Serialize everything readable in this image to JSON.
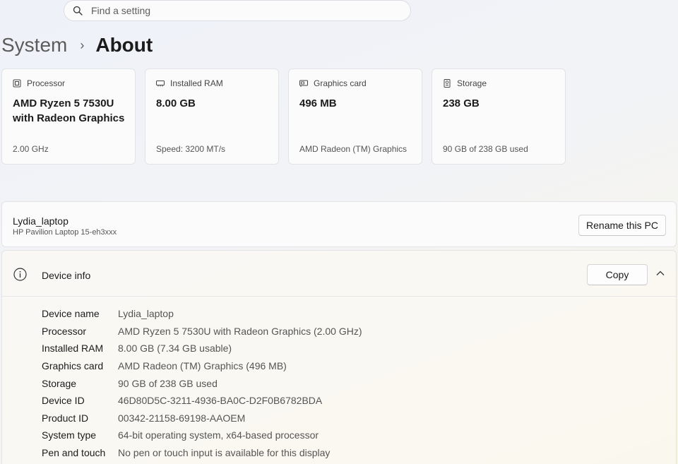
{
  "search": {
    "placeholder": "Find a setting"
  },
  "breadcrumb": {
    "parent": "System",
    "separator": "›",
    "current": "About"
  },
  "specs": [
    {
      "icon": "processor-icon",
      "title": "Processor",
      "value": "AMD Ryzen 5 7530U with Radeon Graphics",
      "sub": "2.00 GHz"
    },
    {
      "icon": "ram-icon",
      "title": "Installed RAM",
      "value": "8.00 GB",
      "sub": "Speed: 3200 MT/s"
    },
    {
      "icon": "graphics-card-icon",
      "title": "Graphics card",
      "value": "496 MB",
      "sub": "AMD Radeon (TM) Graphics"
    },
    {
      "icon": "storage-icon",
      "title": "Storage",
      "value": "238 GB",
      "sub": "90 GB of 238 GB used"
    }
  ],
  "pc": {
    "name": "Lydia_laptop",
    "model": "HP Pavilion Laptop 15-eh3xxx",
    "rename_label": "Rename this PC"
  },
  "device_info": {
    "icon": "info-icon",
    "title": "Device info",
    "copy_label": "Copy",
    "rows": [
      {
        "label": "Device name",
        "value": "Lydia_laptop"
      },
      {
        "label": "Processor",
        "value": "AMD Ryzen 5 7530U with Radeon Graphics (2.00 GHz)"
      },
      {
        "label": "Installed RAM",
        "value": "8.00 GB (7.34 GB usable)"
      },
      {
        "label": "Graphics card",
        "value": "AMD Radeon (TM) Graphics (496 MB)"
      },
      {
        "label": "Storage",
        "value": "90 GB of 238 GB used"
      },
      {
        "label": "Device ID",
        "value": "46D80D5C-3211-4936-BA0C-D2F0B6782BDA"
      },
      {
        "label": "Product ID",
        "value": "00342-21158-69198-AAOEM"
      },
      {
        "label": "System type",
        "value": "64-bit operating system, x64-based processor"
      },
      {
        "label": "Pen and touch",
        "value": "No pen or touch input is available for this display"
      }
    ]
  }
}
